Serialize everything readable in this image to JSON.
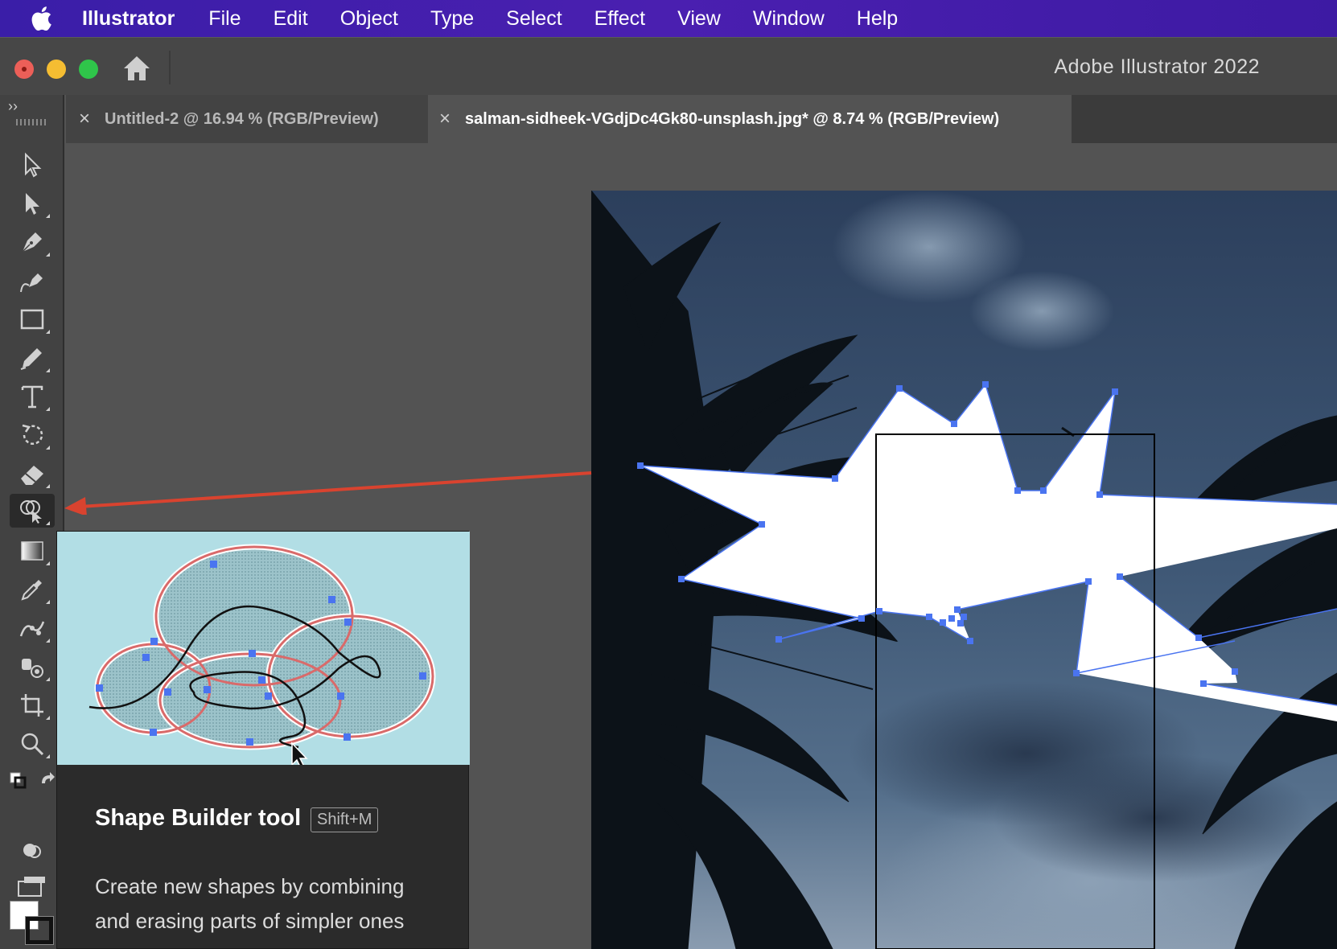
{
  "menubar": {
    "app_name": "Illustrator",
    "items": [
      "File",
      "Edit",
      "Object",
      "Type",
      "Select",
      "Effect",
      "View",
      "Window",
      "Help"
    ]
  },
  "window": {
    "title": "Adobe Illustrator 2022"
  },
  "tabs": [
    {
      "label": "Untitled-2 @ 16.94 % (RGB/Preview)",
      "active": false
    },
    {
      "label": "salman-sidheek-VGdjDc4Gk80-unsplash.jpg* @ 8.74 % (RGB/Preview)",
      "active": true
    }
  ],
  "toolbar": {
    "collapse_label": "››",
    "tools": [
      {
        "name": "selection-tool-icon"
      },
      {
        "name": "direct-selection-tool-icon"
      },
      {
        "name": "pen-tool-icon"
      },
      {
        "name": "curvature-tool-icon"
      },
      {
        "name": "rectangle-tool-icon"
      },
      {
        "name": "pencil-tool-icon"
      },
      {
        "name": "type-tool-icon"
      },
      {
        "name": "rotate-tool-icon"
      },
      {
        "name": "eraser-tool-icon"
      },
      {
        "name": "shape-builder-tool-icon",
        "active": true
      },
      {
        "name": "gradient-tool-icon"
      },
      {
        "name": "eyedropper-tool-icon"
      },
      {
        "name": "puppet-warp-tool-icon"
      },
      {
        "name": "symbol-sprayer-tool-icon"
      },
      {
        "name": "artboard-tool-icon"
      },
      {
        "name": "zoom-tool-icon"
      }
    ]
  },
  "tooltip": {
    "title": "Shape Builder tool",
    "shortcut": "Shift+M",
    "description": "Create new shapes by combining and erasing parts of simpler ones"
  },
  "colors": {
    "menubar": "#4a1fb0",
    "annotation_arrow": "#d9432f",
    "anchor_points": "#4a74f0",
    "tooltip_illustration_bg": "#b2dee5"
  }
}
